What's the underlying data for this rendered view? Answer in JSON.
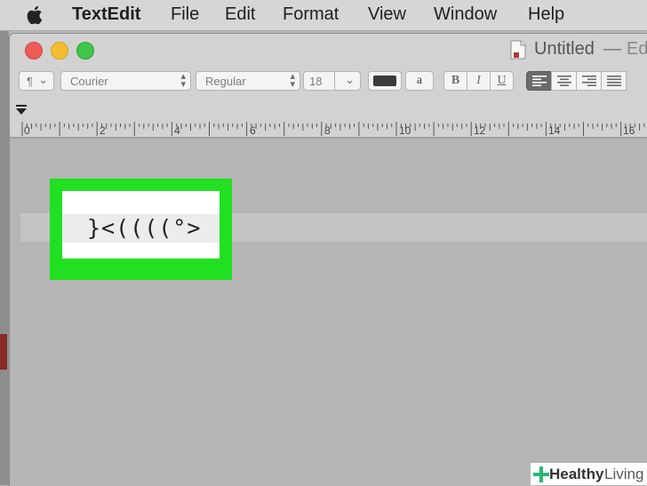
{
  "menubar": {
    "app_name": "TextEdit",
    "items": [
      "File",
      "Edit",
      "Format",
      "View",
      "Window",
      "Help"
    ]
  },
  "window": {
    "title": "Untitled",
    "separator": "—",
    "edited": "Ed"
  },
  "toolbar": {
    "paragraph_label": "¶",
    "font_family": "Courier",
    "font_style": "Regular",
    "font_size": "18",
    "highlight_label": "a",
    "bold_label": "B",
    "italic_label": "I",
    "underline_label": "U",
    "text_color": "#3a3a3a"
  },
  "ruler": {
    "labels": [
      "0",
      "2",
      "4",
      "6",
      "8",
      "10",
      "12",
      "14",
      "16"
    ]
  },
  "document": {
    "text": "}<((((°>"
  },
  "callout": {
    "color": "#21e021"
  },
  "watermark": {
    "brand_bold": "Healthy",
    "brand_light": "Living"
  }
}
